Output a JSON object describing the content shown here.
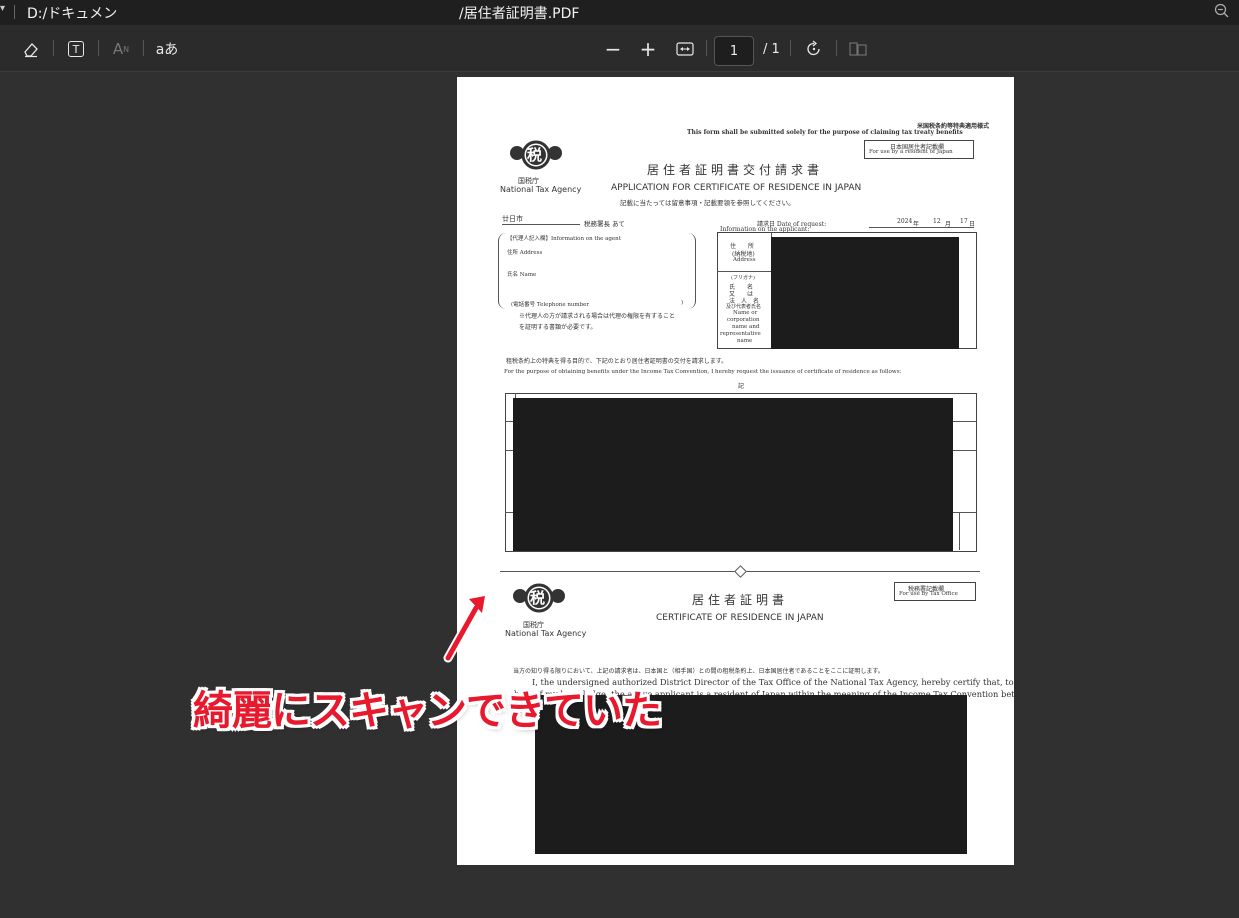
{
  "titlebar": {
    "path": "D:/ドキュメン",
    "filename": "/居住者証明書.PDF"
  },
  "toolbar": {
    "text_size_label": "A",
    "text_size_sup": "N",
    "text_tool_label": "T",
    "language_label": "aあ",
    "zoom_out": "−",
    "zoom_in": "+",
    "current_page": "1",
    "total_pages": "/ 1"
  },
  "document": {
    "header_note": "米国税条約等特典適用様式",
    "header_note_en": "This form shall be submitted solely for the purpose of claiming tax treaty benefits",
    "resident_box_line1": "日本国居住者記載欄",
    "resident_box_line2": "For use by a resident of Japan",
    "logo_char": "税",
    "agency_jp": "国税庁",
    "agency_en": "National Tax Agency",
    "title_jp": "居住者証明書交付請求書",
    "title_en": "APPLICATION FOR CERTIFICATE OF RESIDENCE IN JAPAN",
    "instruction": "記載に当たっては留意事項・記載要領を参照してください。",
    "office": "廿日市",
    "office_suffix": "税務署長 あて",
    "request_date_label": "請求日 Date of request:",
    "request_year": "2024",
    "year_label": "年",
    "request_month": "12",
    "month_label": "月",
    "request_day": "17",
    "day_label": "日",
    "applicant_info": "Information on the applicant:",
    "agent_info": "【代理人記入欄】Information on the agent",
    "agent_address": "住所 Address",
    "agent_name": "氏名 Name",
    "agent_phone": "(電話番号 Telephone number",
    "agent_phone_close": ")",
    "agent_note1": "※代理人の方が請求される場合は代理の権限を有すること",
    "agent_note2": "を証明する書類が必要です。",
    "address_label_jp": "住　　所",
    "address_label_jp2": "(納税地)",
    "address_label_en": "Address",
    "furigana": "(フリガナ)",
    "name_label1": "氏　　名",
    "name_label2": "又　　は",
    "name_label3": "法　人　名",
    "name_label4": "及び代表者氏名",
    "name_label_en1": "Name or",
    "name_label_en2": "corporation",
    "name_label_en3": "name and",
    "name_label_en4": "representative",
    "name_label_en5": "name",
    "purpose_jp": "租税条約上の特典を得る目的で、下記のとおり居住者証明書の交付を請求します。",
    "purpose_en": "For the purpose of obtaining benefits under the Income Tax Convention, I hereby request the issuance of certificate of residence as follows:",
    "ki": "記",
    "tax_office_box1": "税務署記載欄",
    "tax_office_box2": "For use by Tax Office",
    "cert_title_jp": "居住者証明書",
    "cert_title_en": "CERTIFICATE OF RESIDENCE IN JAPAN",
    "cert_text_jp": "当方の知り得る限りにおいて、上記の請求者は、日本国と（相手国）との間の租税条約上、日本国居住者であることをここに証明します。",
    "cert_text_en1": "I, the undersigned authorized District Director of the Tax Office of the National Tax Agency, hereby certify that, to the",
    "cert_text_en2": "best of my knowledge, the above applicant is a resident of Japan within the meaning of the Income Tax Convention between"
  },
  "annotation": {
    "text": "綺麗にスキャンできていた",
    "color": "#e8192c"
  }
}
